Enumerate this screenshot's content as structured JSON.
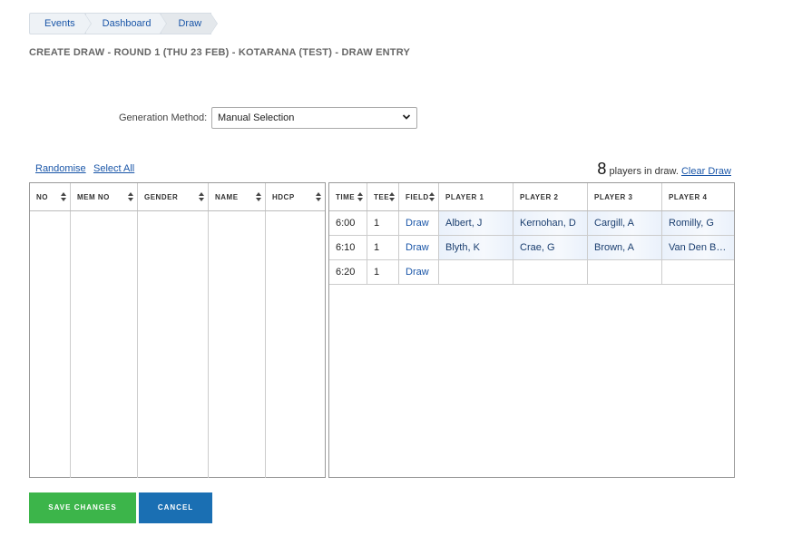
{
  "breadcrumb": [
    "Events",
    "Dashboard",
    "Draw"
  ],
  "page_title": "CREATE DRAW - ROUND 1 (THU 23 FEB) - KOTARANA (TEST) - DRAW ENTRY",
  "generation": {
    "label": "Generation Method:",
    "selected": "Manual Selection"
  },
  "actions": {
    "randomise": "Randomise",
    "select_all": "Select All",
    "player_count": "8",
    "players_text": "players in draw.",
    "clear_draw": "Clear Draw"
  },
  "left_table": {
    "headers": [
      "NO",
      "MEM NO",
      "GENDER",
      "NAME",
      "HDCP"
    ]
  },
  "right_table": {
    "headers": [
      "TIME",
      "TEE",
      "FIELD",
      "PLAYER 1",
      "PLAYER 2",
      "PLAYER 3",
      "PLAYER 4"
    ],
    "rows": [
      {
        "time": "6:00",
        "tee": "1",
        "field": "Draw",
        "p1": "Albert, J",
        "p2": "Kernohan, D",
        "p3": "Cargill, A",
        "p4": "Romilly, G"
      },
      {
        "time": "6:10",
        "tee": "1",
        "field": "Draw",
        "p1": "Blyth, K",
        "p2": "Crae, G",
        "p3": "Brown, A",
        "p4": "Van Den B…"
      },
      {
        "time": "6:20",
        "tee": "1",
        "field": "Draw",
        "p1": "",
        "p2": "",
        "p3": "",
        "p4": ""
      }
    ]
  },
  "buttons": {
    "save": "SAVE CHANGES",
    "cancel": "CANCEL"
  },
  "colors": {
    "save": "#3cb54a",
    "cancel": "#1a6fb3",
    "link": "#1a56a8"
  }
}
